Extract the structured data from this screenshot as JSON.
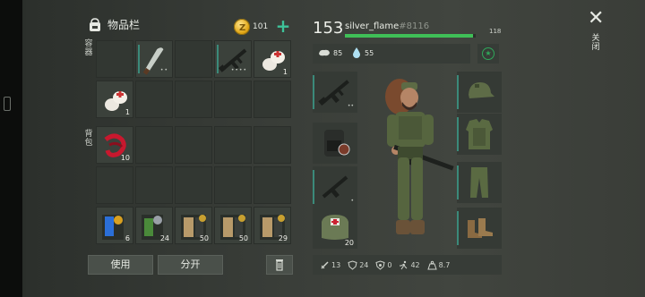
{
  "inventory": {
    "title": "物品栏",
    "coins": "101",
    "section_top": "容器",
    "section_bottom": "背包",
    "top_slots": [
      {
        "item": "empty"
      },
      {
        "item": "machete",
        "dots": "••"
      },
      {
        "item": "empty"
      },
      {
        "item": "assault-rifle",
        "dots": "••••"
      },
      {
        "item": "bandage",
        "qty": "1"
      },
      {
        "item": "bandage",
        "qty": "1"
      },
      {
        "item": "empty"
      },
      {
        "item": "empty"
      },
      {
        "item": "empty"
      },
      {
        "item": "empty"
      }
    ],
    "bag_slots": [
      {
        "item": "red-bandage",
        "qty": "10"
      },
      {
        "item": "empty"
      },
      {
        "item": "empty"
      },
      {
        "item": "empty"
      },
      {
        "item": "empty"
      },
      {
        "item": "empty"
      },
      {
        "item": "empty"
      },
      {
        "item": "empty"
      },
      {
        "item": "empty"
      },
      {
        "item": "empty"
      },
      {
        "item": "blue-book",
        "qty": "6"
      },
      {
        "item": "green-book",
        "qty": "24"
      },
      {
        "item": "tan-book",
        "qty": "50"
      },
      {
        "item": "tan-book",
        "qty": "50"
      },
      {
        "item": "tan-book",
        "qty": "29"
      }
    ],
    "use_button": "使用",
    "split_button": "分开"
  },
  "character": {
    "level": "153",
    "username": "silver_flame",
    "tag": "#8116",
    "xp": "118",
    "xp_fraction": 0.98,
    "food": "85",
    "water": "55",
    "weapon_dots": "••",
    "secondary_dots": "•",
    "medkit_qty": "20",
    "stats": {
      "attack": "13",
      "armor": "24",
      "radiation": "0",
      "speed": "42",
      "weight": "8.7"
    }
  },
  "close_label": "关闭",
  "colors": {
    "accent": "#3ec39a",
    "xp": "#3fbf57",
    "coin": "#e0a515"
  }
}
